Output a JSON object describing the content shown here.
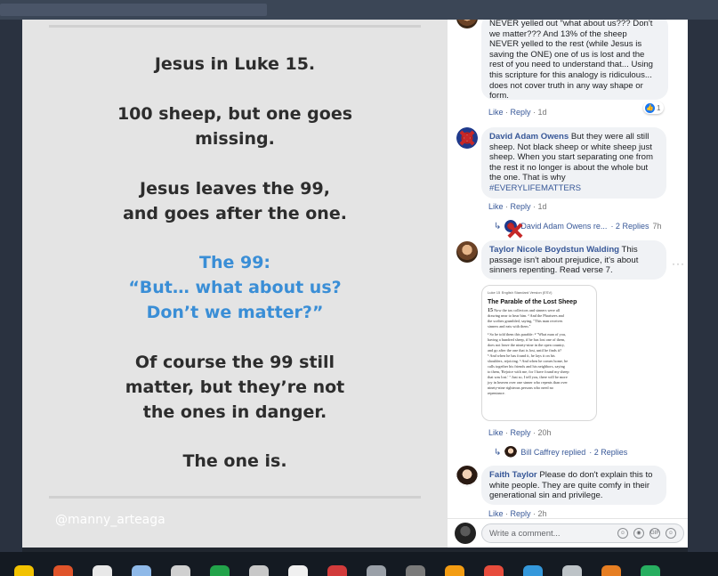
{
  "post": {
    "lines": [
      "Jesus in Luke 15.",
      "100 sheep, but one goes",
      "missing.",
      "Jesus leaves the 99,",
      "and goes after the one.",
      "The 99:",
      "“But… what about us?",
      "Don’t we matter?”",
      "Of course the 99 still",
      "matter, but they’re not",
      "the ones in danger.",
      "The one is."
    ],
    "watermark": "@manny_arteaga"
  },
  "comments": {
    "c1": {
      "text_lines": [
        "NEVER yelled out \"what about us??? Don't",
        "we matter??? And 13% of the sheep",
        "NEVER yelled to the rest (while Jesus is",
        "saving the ONE) one of us is lost and the",
        "rest of you need to understand that... Using",
        "this scripture for this analogy is ridiculous...",
        "does not cover truth in any way shape or",
        "form."
      ],
      "like": "Like",
      "reply": "Reply",
      "time": "1d",
      "reaction_count": "1"
    },
    "c2": {
      "author": "David Adam Owens",
      "text_first": " But they were all still",
      "text_lines": [
        "sheep. Not black sheep or white sheep just",
        "sheep. When you start separating one from",
        "the rest it no longer is about the whole but",
        "the one. That is why"
      ],
      "hashtag": "#EVERYLIFEMATTERS",
      "like": "Like",
      "reply": "Reply",
      "time": "1d",
      "reply_thread": {
        "author": "David Adam Owens re...",
        "count": "· 2 Replies",
        "time": "7h"
      }
    },
    "c3": {
      "author": "Taylor Nicole Boydstun Walding",
      "text_first": " This",
      "text_lines": [
        "passage isn't about prejudice, it's about",
        "sinners repenting. Read verse 7."
      ],
      "like": "Like",
      "reply": "Reply",
      "time": "20h",
      "more": "···",
      "reply_thread": {
        "author": "Bill Caffrey replied",
        "count": "· 2 Replies"
      },
      "bible": {
        "ref": "Luke 15",
        "version": "English Standard Version (ESV)",
        "title": "The Parable of the Lost Sheep",
        "verse_num": "15",
        "body_lines": [
          "Now the tax collectors and sinners were all",
          "drawing near to hear him. ² And the Pharisees and",
          "the scribes grumbled, saying, \"This man receives",
          "sinners and eats with them.\"",
          "³ So he told them this parable: ⁴ \"What man of you,",
          "having a hundred sheep, if he has lost one of them,",
          "does not leave the ninety-nine in the open country,",
          "and go after the one that is lost, until he finds it?",
          "⁵ And when he has found it, he lays it on his",
          "shoulders, rejoicing. ⁶ And when he comes home, he",
          "calls together his friends and his neighbors, saying",
          "to them, 'Rejoice with me, for I have found my sheep",
          "that was lost.' ⁷ Just so, I tell you, there will be more",
          "joy in heaven over one sinner who repents than over",
          "ninety-nine righteous persons who need no",
          "repentance."
        ]
      }
    },
    "c4": {
      "author": "Faith Taylor",
      "text_first": " Please do don't explain this to",
      "text_lines": [
        "white people. They are quite comfy in their",
        "generational sin and privilege."
      ],
      "like": "Like",
      "reply": "Reply",
      "time": "2h"
    }
  },
  "input": {
    "placeholder": "Write a comment...",
    "icons": [
      "emoji-icon",
      "camera-icon",
      "gif-icon",
      "sticker-icon"
    ],
    "gif_label": "GIF"
  },
  "colors": {
    "link": "#385898",
    "accent_blue": "#3a8ed6",
    "bubble": "#f0f2f5"
  }
}
